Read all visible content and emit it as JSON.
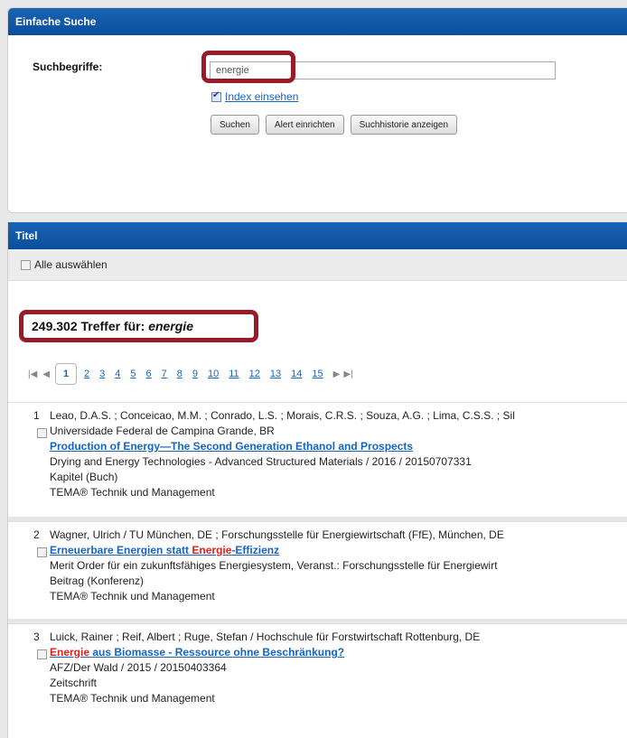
{
  "search_panel": {
    "header": "Einfache Suche",
    "label": "Suchbegriffe:",
    "query": "energie",
    "index_link": "Index einsehen",
    "buttons": {
      "search": "Suchen",
      "alert": "Alert einrichten",
      "history": "Suchhistorie anzeigen"
    }
  },
  "results_panel": {
    "header": "Titel",
    "select_all": "Alle auswählen",
    "hits_count": "249.302 Treffer für:",
    "hits_term": "energie",
    "pager": {
      "current": "1",
      "pages": [
        "2",
        "3",
        "4",
        "5",
        "6",
        "7",
        "8",
        "9",
        "10",
        "11",
        "12",
        "13",
        "14",
        "15"
      ]
    },
    "results": [
      {
        "number": "1",
        "authors": "Leao, D.A.S. ; Conceicao, M.M. ; Conrado, L.S. ; Morais, C.R.S. ; Souza, A.G. ; Lima, C.S.S. ; Sil",
        "affiliation": "Universidade Federal de Campina Grande, BR",
        "title": "Production of Energy—The Second Generation Ethanol and Prospects",
        "source": "Drying and Energy Technologies - Advanced Structured Materials / 2016 / 20150707331",
        "type": "Kapitel (Buch)",
        "database": "TEMA® Technik und Management"
      },
      {
        "number": "2",
        "authors": "Wagner, Ulrich / TU München, DE ; Forschungsstelle für Energiewirtschaft (FfE), München, DE",
        "title_pre": "Erneuerbare Energien statt ",
        "title_hl": "Energie",
        "title_post": "-Effizienz",
        "source": "Merit Order für ein zukunftsfähiges Energiesystem, Veranst.: Forschungsstelle für Energiewirt",
        "type": "Beitrag (Konferenz)",
        "database": "TEMA® Technik und Management"
      },
      {
        "number": "3",
        "authors": "Luick, Rainer ; Reif, Albert ; Ruge, Stefan / Hochschule für Forstwirtschaft Rottenburg, DE",
        "title_hl": "Energie",
        "title_post": " aus Biomasse - Ressource ohne Beschränkung?",
        "source": "AFZ/Der Wald / 2015 / 20150403364",
        "type": "Zeitschrift",
        "database": "TEMA® Technik und Management"
      }
    ]
  }
}
